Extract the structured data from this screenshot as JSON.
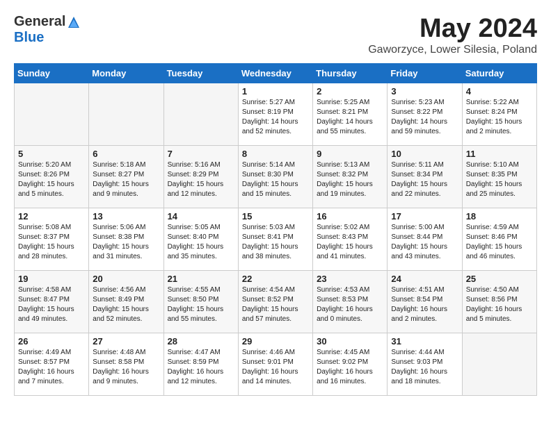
{
  "header": {
    "logo_general": "General",
    "logo_blue": "Blue",
    "month_title": "May 2024",
    "location": "Gaworzyce, Lower Silesia, Poland"
  },
  "days_of_week": [
    "Sunday",
    "Monday",
    "Tuesday",
    "Wednesday",
    "Thursday",
    "Friday",
    "Saturday"
  ],
  "weeks": [
    [
      {
        "day": "",
        "info": "",
        "empty": true
      },
      {
        "day": "",
        "info": "",
        "empty": true
      },
      {
        "day": "",
        "info": "",
        "empty": true
      },
      {
        "day": "1",
        "info": "Sunrise: 5:27 AM\nSunset: 8:19 PM\nDaylight: 14 hours\nand 52 minutes."
      },
      {
        "day": "2",
        "info": "Sunrise: 5:25 AM\nSunset: 8:21 PM\nDaylight: 14 hours\nand 55 minutes."
      },
      {
        "day": "3",
        "info": "Sunrise: 5:23 AM\nSunset: 8:22 PM\nDaylight: 14 hours\nand 59 minutes."
      },
      {
        "day": "4",
        "info": "Sunrise: 5:22 AM\nSunset: 8:24 PM\nDaylight: 15 hours\nand 2 minutes."
      }
    ],
    [
      {
        "day": "5",
        "info": "Sunrise: 5:20 AM\nSunset: 8:26 PM\nDaylight: 15 hours\nand 5 minutes."
      },
      {
        "day": "6",
        "info": "Sunrise: 5:18 AM\nSunset: 8:27 PM\nDaylight: 15 hours\nand 9 minutes."
      },
      {
        "day": "7",
        "info": "Sunrise: 5:16 AM\nSunset: 8:29 PM\nDaylight: 15 hours\nand 12 minutes."
      },
      {
        "day": "8",
        "info": "Sunrise: 5:14 AM\nSunset: 8:30 PM\nDaylight: 15 hours\nand 15 minutes."
      },
      {
        "day": "9",
        "info": "Sunrise: 5:13 AM\nSunset: 8:32 PM\nDaylight: 15 hours\nand 19 minutes."
      },
      {
        "day": "10",
        "info": "Sunrise: 5:11 AM\nSunset: 8:34 PM\nDaylight: 15 hours\nand 22 minutes."
      },
      {
        "day": "11",
        "info": "Sunrise: 5:10 AM\nSunset: 8:35 PM\nDaylight: 15 hours\nand 25 minutes."
      }
    ],
    [
      {
        "day": "12",
        "info": "Sunrise: 5:08 AM\nSunset: 8:37 PM\nDaylight: 15 hours\nand 28 minutes."
      },
      {
        "day": "13",
        "info": "Sunrise: 5:06 AM\nSunset: 8:38 PM\nDaylight: 15 hours\nand 31 minutes."
      },
      {
        "day": "14",
        "info": "Sunrise: 5:05 AM\nSunset: 8:40 PM\nDaylight: 15 hours\nand 35 minutes."
      },
      {
        "day": "15",
        "info": "Sunrise: 5:03 AM\nSunset: 8:41 PM\nDaylight: 15 hours\nand 38 minutes."
      },
      {
        "day": "16",
        "info": "Sunrise: 5:02 AM\nSunset: 8:43 PM\nDaylight: 15 hours\nand 41 minutes."
      },
      {
        "day": "17",
        "info": "Sunrise: 5:00 AM\nSunset: 8:44 PM\nDaylight: 15 hours\nand 43 minutes."
      },
      {
        "day": "18",
        "info": "Sunrise: 4:59 AM\nSunset: 8:46 PM\nDaylight: 15 hours\nand 46 minutes."
      }
    ],
    [
      {
        "day": "19",
        "info": "Sunrise: 4:58 AM\nSunset: 8:47 PM\nDaylight: 15 hours\nand 49 minutes."
      },
      {
        "day": "20",
        "info": "Sunrise: 4:56 AM\nSunset: 8:49 PM\nDaylight: 15 hours\nand 52 minutes."
      },
      {
        "day": "21",
        "info": "Sunrise: 4:55 AM\nSunset: 8:50 PM\nDaylight: 15 hours\nand 55 minutes."
      },
      {
        "day": "22",
        "info": "Sunrise: 4:54 AM\nSunset: 8:52 PM\nDaylight: 15 hours\nand 57 minutes."
      },
      {
        "day": "23",
        "info": "Sunrise: 4:53 AM\nSunset: 8:53 PM\nDaylight: 16 hours\nand 0 minutes."
      },
      {
        "day": "24",
        "info": "Sunrise: 4:51 AM\nSunset: 8:54 PM\nDaylight: 16 hours\nand 2 minutes."
      },
      {
        "day": "25",
        "info": "Sunrise: 4:50 AM\nSunset: 8:56 PM\nDaylight: 16 hours\nand 5 minutes."
      }
    ],
    [
      {
        "day": "26",
        "info": "Sunrise: 4:49 AM\nSunset: 8:57 PM\nDaylight: 16 hours\nand 7 minutes."
      },
      {
        "day": "27",
        "info": "Sunrise: 4:48 AM\nSunset: 8:58 PM\nDaylight: 16 hours\nand 9 minutes."
      },
      {
        "day": "28",
        "info": "Sunrise: 4:47 AM\nSunset: 8:59 PM\nDaylight: 16 hours\nand 12 minutes."
      },
      {
        "day": "29",
        "info": "Sunrise: 4:46 AM\nSunset: 9:01 PM\nDaylight: 16 hours\nand 14 minutes."
      },
      {
        "day": "30",
        "info": "Sunrise: 4:45 AM\nSunset: 9:02 PM\nDaylight: 16 hours\nand 16 minutes."
      },
      {
        "day": "31",
        "info": "Sunrise: 4:44 AM\nSunset: 9:03 PM\nDaylight: 16 hours\nand 18 minutes."
      },
      {
        "day": "",
        "info": "",
        "empty": true
      }
    ]
  ]
}
